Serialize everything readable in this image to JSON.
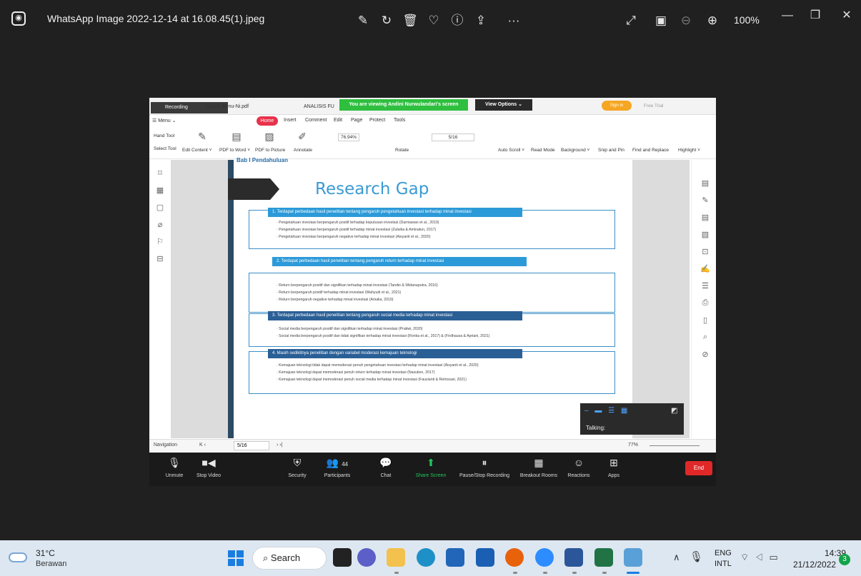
{
  "titlebar": {
    "file_title": "WhatsApp Image 2022-12-14 at 16.08.45(1).jpeg",
    "zoom": "100%"
  },
  "zoom_screen": {
    "recording": "Recording",
    "tab1": "Kuliah Tamu-Ni.pdf",
    "tab2": "ANALISIS FU",
    "banner": "You are viewing Andini Nurwulandari's screen",
    "view_options": "View Options ⌄",
    "sign_in": "Sign in",
    "free_trial": "Free Trial",
    "menu": {
      "menu": "☰ Menu ⌄",
      "home": "Home",
      "insert": "Insert",
      "comment": "Comment",
      "edit": "Edit",
      "page": "Page",
      "protect": "Protect",
      "tools": "Tools"
    },
    "ribbon": {
      "hand_tool": "Hand Tool",
      "select_tool": "Select Tool",
      "edit_content": "Edit Content ˅",
      "pdf_to_word": "PDF to Word ˅",
      "pdf_to_picture": "PDF to Picture",
      "annotate": "Annotate",
      "zoom": "76.94%",
      "rotate": "Rotate",
      "page": "5/16",
      "auto_scroll": "Auto Scroll ˅",
      "read_mode": "Read Mode",
      "background": "Background ˅",
      "snip_pin": "Snip and Pin",
      "find_replace": "Find and Replace",
      "highlight": "Highlight ˅"
    },
    "slide": {
      "top_text": "Bab I Pendahuluan",
      "title": "Research Gap",
      "box1_head": "1. Terdapat perbedaan hasil penelitian tentang pengaruh pengetahuan investasi terhadap minat investasi",
      "box1_lines": [
        "· Pengetahuan investasi berpengaruh positif terhadap keputusan investasi (Darmawan et al., 2019)",
        "· Pengetahuan investasi berpengaruh positif terhadap minat investasi (Zulaika & Aminatun, 2017)",
        "· Pengetahuan investasi berpengaruh negative terhadap minat investasi (Aisyanti et al., 2020)"
      ],
      "box2_head": "2. Terdapat perbedaan hasil penelitian tentang pengaruh return terhadap minat investasi",
      "box2_lines": [
        "· Return berpengaruh positif dan signifikan terhadap minat investasi (Tandio & Widanaputra, 2016)",
        "· Return berpengaruh positif terhadap minat investasi (Wahyudi et al., 2021)",
        "· Return berpengaruh negative terhadap minat investasi (Amalia, 2019)"
      ],
      "box3_head": "3. Terdapat perbedaan hasil penelitian tentang pengaruh social media terhadap minat investasi",
      "box3_lines": [
        "· Social media berpengaruh positif dan signifikan terhadap minat investasi (Pratiwi, 2020)",
        "· Social media berpengaruh positif dan tidak signifikan terhadap minat investasi (Ronka et al., 2017) & (Firdhausa & Apriani, 2021)"
      ],
      "box4_head": "4. Masih sedikitnya penelitian dengan variabel moderasi kemajuan teknologi",
      "box4_lines": [
        "· Kemajuan teknologi tidak dapat memoderasi penuh pengetahuan investasi terhadap minat investasi (Aisyanti et al., 2020)",
        "· Kemajuan teknologi dapat memoderasi penuh return terhadap minat investasi (Nasution, 2017)",
        "· Kemajuan teknologi dapat memoderasi penuh social media terhadap minat investasi (Fauzianti & Retnosari, 2021)"
      ]
    },
    "talking": "Talking:",
    "nav": {
      "navigation": "Navigation",
      "page": "5/16",
      "zoom": "77%"
    },
    "controls": {
      "unmute": "Unmute",
      "stop_video": "Stop Video",
      "security": "Security",
      "participants": "Participants",
      "participants_count": "44",
      "chat": "Chat",
      "share_screen": "Share Screen",
      "pause_recording": "Pause/Stop Recording",
      "breakout": "Breakout Rooms",
      "reactions": "Reactions",
      "apps": "Apps",
      "end": "End"
    }
  },
  "taskbar": {
    "temp": "31°C",
    "weather": "Berawan",
    "search": "Search",
    "lang1": "ENG",
    "lang2": "INTL",
    "time": "14:39",
    "date": "21/12/2022",
    "notifications": "3"
  }
}
